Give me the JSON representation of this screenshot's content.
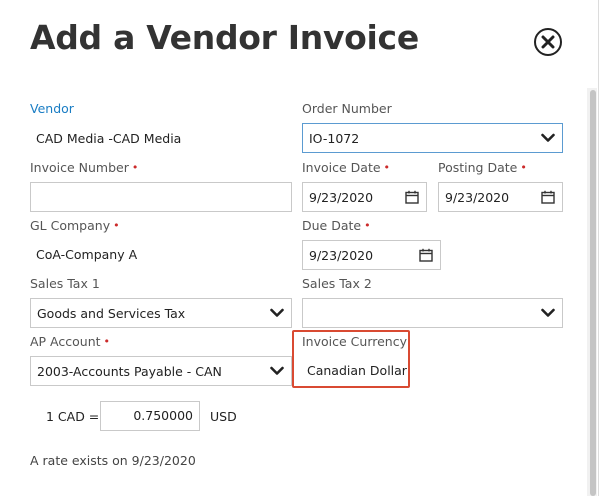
{
  "dialog": {
    "title": "Add a Vendor Invoice",
    "close_icon": "close-circle-icon"
  },
  "vendor": {
    "label": "Vendor",
    "value": "CAD Media -CAD Media"
  },
  "order_number": {
    "label": "Order Number",
    "value": "IO-1072",
    "icon": "chevron-down-icon"
  },
  "invoice_number": {
    "label": "Invoice Number",
    "required_mark": "•",
    "value": ""
  },
  "invoice_date": {
    "label": "Invoice Date",
    "required_mark": "•",
    "value": "9/23/2020",
    "icon": "calendar-icon"
  },
  "posting_date": {
    "label": "Posting Date",
    "required_mark": "•",
    "value": "9/23/2020",
    "icon": "calendar-icon"
  },
  "gl_company": {
    "label": "GL Company",
    "required_mark": "•",
    "value": "CoA-Company A"
  },
  "due_date": {
    "label": "Due Date",
    "required_mark": "•",
    "value": "9/23/2020",
    "icon": "calendar-icon"
  },
  "sales_tax_1": {
    "label": "Sales Tax 1",
    "value": "Goods and Services Tax",
    "icon": "chevron-down-icon"
  },
  "sales_tax_2": {
    "label": "Sales Tax 2",
    "value": "",
    "icon": "chevron-down-icon"
  },
  "ap_account": {
    "label": "AP Account",
    "required_mark": "•",
    "value": "2003-Accounts Payable - CAN",
    "icon": "chevron-down-icon"
  },
  "invoice_currency": {
    "label": "Invoice Currency",
    "value": "Canadian Dollar",
    "highlight_color": "#d94a32"
  },
  "exchange_rate": {
    "from_label": "1 CAD =",
    "value": "0.750000",
    "to_label": "USD"
  },
  "rate_note": "A rate exists on 9/23/2020",
  "colors": {
    "link": "#1a7dc4",
    "required": "#cc2b2b",
    "focus_border": "#5b9bd1"
  }
}
